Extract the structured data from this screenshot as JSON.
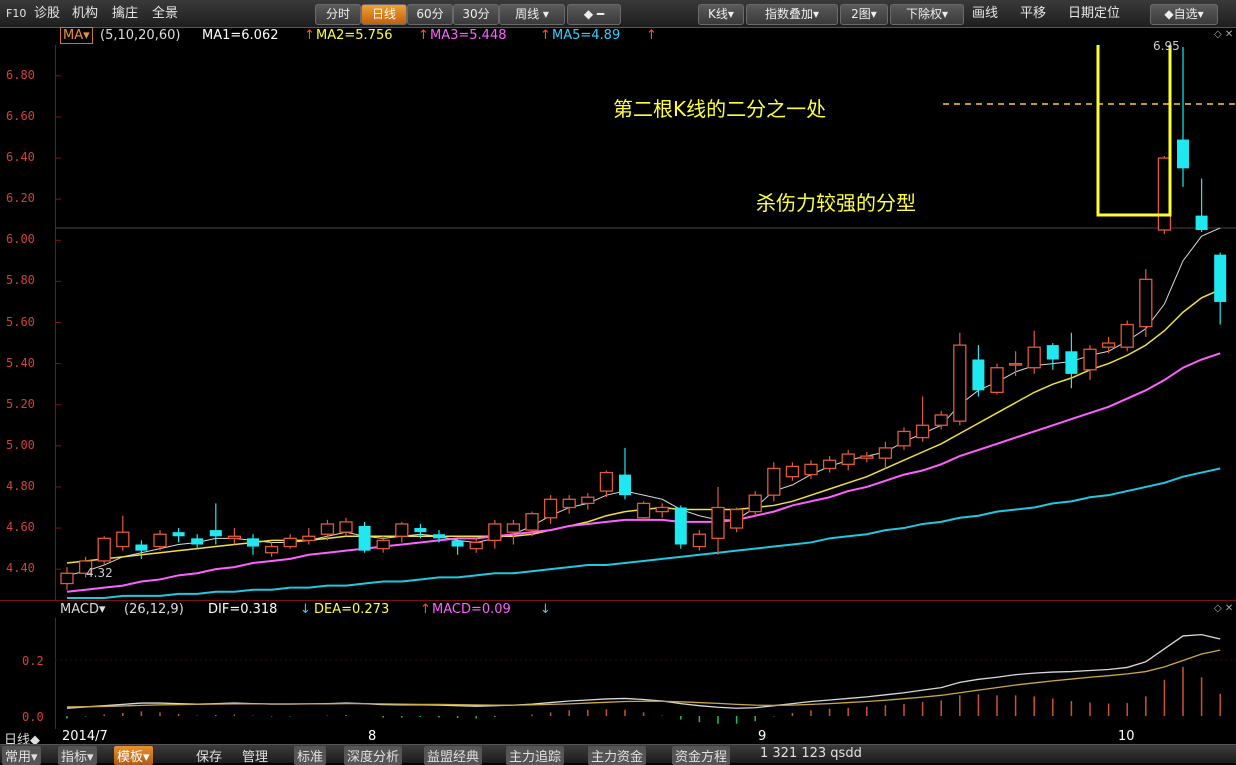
{
  "toolbar": {
    "left": [
      "F10",
      "诊股",
      "机构",
      "擒庄",
      "全景"
    ],
    "periods": [
      {
        "label": "分时",
        "active": false
      },
      {
        "label": "日线",
        "active": true
      },
      {
        "label": "60分",
        "active": false
      },
      {
        "label": "30分",
        "active": false
      },
      {
        "label": "周线 ▾",
        "active": false
      }
    ],
    "nav_arrows": "◆ ━",
    "right": [
      "K线▾",
      "指数叠加▾",
      "2图▾",
      "下除权▾",
      "画线",
      "平移",
      "日期定位",
      "◆自选▾"
    ]
  },
  "ma_bar": {
    "selector": "MA▾",
    "params": "(5,10,20,60)",
    "ma1": "MA1=6.062",
    "ma2": "MA2=5.756",
    "ma3": "MA3=5.448",
    "ma5": "MA5=4.89",
    "arrow_up": "↑"
  },
  "price_axis": [
    "6.80",
    "6.60",
    "6.40",
    "6.20",
    "6.00",
    "5.80",
    "5.60",
    "5.40",
    "5.20",
    "5.00",
    "4.80",
    "4.60",
    "4.40"
  ],
  "annotations": {
    "half_line": "第二根K线的二分之一处",
    "fractal": "杀伤力较强的分型",
    "high_label": "6.95",
    "low_label": "4.32"
  },
  "macd_bar": {
    "selector": "MACD▾",
    "params": "(26,12,9)",
    "dif": "DIF=0.318",
    "dea": "DEA=0.273",
    "macd": "MACD=0.09",
    "arrow_down": "↓",
    "arrow_up": "↑"
  },
  "macd_axis": [
    "0.2",
    "0.0"
  ],
  "date_axis": {
    "period_label": "日线◆",
    "start": "2014/7",
    "marks": [
      "8",
      "9",
      "10"
    ]
  },
  "bottom_tabs": [
    {
      "label": "常用▾",
      "on": false
    },
    {
      "label": "指标▾",
      "on": false
    },
    {
      "label": "模板▾",
      "on": true
    },
    {
      "label": "保存",
      "on": false
    },
    {
      "label": "管理",
      "on": false
    },
    {
      "label": "标准",
      "on": false
    },
    {
      "label": "深度分析",
      "on": false
    },
    {
      "label": "益盟经典",
      "on": false
    },
    {
      "label": "主力追踪",
      "on": false
    },
    {
      "label": "主力资金",
      "on": false
    },
    {
      "label": "资金方程",
      "on": false
    },
    {
      "label": "1 321 123 qsdd",
      "on": false
    }
  ],
  "chart_data": {
    "type": "candlestick",
    "ylim": [
      4.25,
      6.95
    ],
    "candles": [
      [
        4.33,
        4.38,
        4.3,
        4.41
      ],
      [
        4.38,
        4.44,
        4.36,
        4.46
      ],
      [
        4.44,
        4.55,
        4.42,
        4.56
      ],
      [
        4.51,
        4.58,
        4.49,
        4.66
      ],
      [
        4.52,
        4.49,
        4.45,
        4.54
      ],
      [
        4.51,
        4.57,
        4.49,
        4.59
      ],
      [
        4.58,
        4.56,
        4.53,
        4.6
      ],
      [
        4.55,
        4.52,
        4.5,
        4.57
      ],
      [
        4.59,
        4.56,
        4.52,
        4.72
      ],
      [
        4.55,
        4.56,
        4.52,
        4.6
      ],
      [
        4.55,
        4.51,
        4.47,
        4.57
      ],
      [
        4.48,
        4.51,
        4.46,
        4.53
      ],
      [
        4.51,
        4.55,
        4.5,
        4.57
      ],
      [
        4.54,
        4.56,
        4.52,
        4.6
      ],
      [
        4.57,
        4.62,
        4.54,
        4.64
      ],
      [
        4.58,
        4.63,
        4.56,
        4.65
      ],
      [
        4.61,
        4.49,
        4.48,
        4.63
      ],
      [
        4.5,
        4.54,
        4.48,
        4.56
      ],
      [
        4.56,
        4.62,
        4.53,
        4.63
      ],
      [
        4.6,
        4.58,
        4.55,
        4.62
      ],
      [
        4.57,
        4.55,
        4.53,
        4.59
      ],
      [
        4.54,
        4.51,
        4.47,
        4.55
      ],
      [
        4.5,
        4.53,
        4.48,
        4.55
      ],
      [
        4.54,
        4.62,
        4.5,
        4.64
      ],
      [
        4.58,
        4.62,
        4.52,
        4.64
      ],
      [
        4.59,
        4.67,
        4.56,
        4.68
      ],
      [
        4.65,
        4.74,
        4.62,
        4.76
      ],
      [
        4.7,
        4.74,
        4.67,
        4.76
      ],
      [
        4.72,
        4.75,
        4.69,
        4.77
      ],
      [
        4.78,
        4.87,
        4.75,
        4.88
      ],
      [
        4.86,
        4.76,
        4.74,
        4.99
      ],
      [
        4.65,
        4.72,
        4.64,
        4.73
      ],
      [
        4.68,
        4.7,
        4.65,
        4.72
      ],
      [
        4.7,
        4.52,
        4.5,
        4.71
      ],
      [
        4.51,
        4.57,
        4.49,
        4.59
      ],
      [
        4.55,
        4.7,
        4.47,
        4.8
      ],
      [
        4.6,
        4.69,
        4.58,
        4.7
      ],
      [
        4.68,
        4.76,
        4.66,
        4.78
      ],
      [
        4.76,
        4.89,
        4.73,
        4.92
      ],
      [
        4.85,
        4.9,
        4.83,
        4.92
      ],
      [
        4.86,
        4.91,
        4.84,
        4.93
      ],
      [
        4.89,
        4.93,
        4.87,
        4.95
      ],
      [
        4.91,
        4.96,
        4.88,
        4.98
      ],
      [
        4.94,
        4.95,
        4.92,
        4.97
      ],
      [
        4.94,
        4.99,
        4.89,
        5.02
      ],
      [
        5.0,
        5.07,
        4.98,
        5.09
      ],
      [
        5.04,
        5.1,
        5.02,
        5.24
      ],
      [
        5.1,
        5.15,
        5.08,
        5.17
      ],
      [
        5.12,
        5.49,
        5.1,
        5.55
      ],
      [
        5.42,
        5.27,
        5.24,
        5.49
      ],
      [
        5.26,
        5.38,
        5.25,
        5.4
      ],
      [
        5.4,
        5.4,
        5.34,
        5.46
      ],
      [
        5.38,
        5.48,
        5.35,
        5.56
      ],
      [
        5.49,
        5.42,
        5.37,
        5.5
      ],
      [
        5.46,
        5.35,
        5.28,
        5.55
      ],
      [
        5.37,
        5.47,
        5.32,
        5.49
      ],
      [
        5.48,
        5.5,
        5.45,
        5.53
      ],
      [
        5.48,
        5.59,
        5.46,
        5.61
      ],
      [
        5.58,
        5.81,
        5.53,
        5.86
      ],
      [
        6.05,
        6.4,
        6.03,
        6.41
      ],
      [
        6.49,
        6.35,
        6.26,
        6.94
      ],
      [
        6.12,
        6.05,
        6.04,
        6.3
      ],
      [
        5.93,
        5.7,
        5.59,
        5.94
      ]
    ],
    "series": [
      {
        "name": "MA1",
        "values": [
          4.37,
          4.39,
          4.42,
          4.46,
          4.48,
          4.5,
          4.52,
          4.53,
          4.55,
          4.55,
          4.54,
          4.53,
          4.53,
          4.54,
          4.56,
          4.58,
          4.56,
          4.55,
          4.56,
          4.57,
          4.56,
          4.54,
          4.53,
          4.55,
          4.57,
          4.61,
          4.66,
          4.7,
          4.72,
          4.76,
          4.78,
          4.76,
          4.74,
          4.69,
          4.66,
          4.64,
          4.64,
          4.7,
          4.78,
          4.81,
          4.86,
          4.9,
          4.93,
          4.95,
          4.97,
          5.02,
          5.06,
          5.1,
          5.2,
          5.27,
          5.31,
          5.36,
          5.39,
          5.4,
          5.41,
          5.44,
          5.46,
          5.51,
          5.57,
          5.69,
          5.9,
          6.02,
          6.06
        ]
      },
      {
        "name": "MA2",
        "values": [
          4.43,
          4.44,
          4.45,
          4.46,
          4.47,
          4.48,
          4.49,
          4.5,
          4.51,
          4.52,
          4.53,
          4.54,
          4.54,
          4.54,
          4.55,
          4.56,
          4.56,
          4.56,
          4.56,
          4.56,
          4.56,
          4.56,
          4.56,
          4.56,
          4.56,
          4.57,
          4.59,
          4.61,
          4.63,
          4.66,
          4.68,
          4.69,
          4.7,
          4.69,
          4.69,
          4.69,
          4.69,
          4.7,
          4.71,
          4.73,
          4.76,
          4.79,
          4.82,
          4.85,
          4.89,
          4.93,
          4.97,
          5.01,
          5.06,
          5.11,
          5.16,
          5.21,
          5.26,
          5.3,
          5.33,
          5.37,
          5.4,
          5.44,
          5.49,
          5.56,
          5.65,
          5.72,
          5.76
        ]
      },
      {
        "name": "MA3",
        "values": [
          4.29,
          4.3,
          4.31,
          4.32,
          4.34,
          4.35,
          4.37,
          4.38,
          4.4,
          4.41,
          4.43,
          4.44,
          4.45,
          4.47,
          4.48,
          4.49,
          4.5,
          4.51,
          4.52,
          4.53,
          4.54,
          4.55,
          4.55,
          4.56,
          4.57,
          4.58,
          4.59,
          4.61,
          4.62,
          4.63,
          4.64,
          4.64,
          4.64,
          4.63,
          4.63,
          4.63,
          4.64,
          4.66,
          4.68,
          4.71,
          4.73,
          4.75,
          4.78,
          4.8,
          4.83,
          4.86,
          4.88,
          4.91,
          4.95,
          4.98,
          5.01,
          5.04,
          5.07,
          5.1,
          5.13,
          5.16,
          5.19,
          5.23,
          5.27,
          5.32,
          5.38,
          5.42,
          5.45
        ]
      },
      {
        "name": "MA5",
        "values": [
          4.26,
          4.26,
          4.26,
          4.27,
          4.27,
          4.27,
          4.28,
          4.28,
          4.29,
          4.29,
          4.3,
          4.3,
          4.31,
          4.31,
          4.32,
          4.32,
          4.33,
          4.34,
          4.34,
          4.35,
          4.36,
          4.36,
          4.37,
          4.38,
          4.38,
          4.39,
          4.4,
          4.41,
          4.42,
          4.42,
          4.43,
          4.44,
          4.45,
          4.46,
          4.47,
          4.48,
          4.49,
          4.5,
          4.51,
          4.52,
          4.53,
          4.55,
          4.56,
          4.57,
          4.59,
          4.6,
          4.62,
          4.63,
          4.65,
          4.66,
          4.68,
          4.69,
          4.7,
          4.72,
          4.73,
          4.75,
          4.76,
          4.78,
          4.8,
          4.82,
          4.85,
          4.87,
          4.89
        ]
      }
    ],
    "macd": {
      "ylim": [
        0.0,
        0.36
      ],
      "dif": [
        0.03,
        0.035,
        0.04,
        0.045,
        0.05,
        0.05,
        0.048,
        0.046,
        0.048,
        0.05,
        0.048,
        0.046,
        0.046,
        0.047,
        0.048,
        0.05,
        0.048,
        0.044,
        0.043,
        0.043,
        0.042,
        0.04,
        0.038,
        0.04,
        0.042,
        0.046,
        0.052,
        0.058,
        0.062,
        0.066,
        0.068,
        0.064,
        0.058,
        0.048,
        0.04,
        0.034,
        0.03,
        0.032,
        0.04,
        0.048,
        0.056,
        0.062,
        0.068,
        0.074,
        0.082,
        0.09,
        0.1,
        0.11,
        0.13,
        0.142,
        0.15,
        0.16,
        0.166,
        0.17,
        0.172,
        0.176,
        0.18,
        0.188,
        0.21,
        0.26,
        0.31,
        0.315,
        0.298
      ],
      "dea": [
        0.035,
        0.036,
        0.037,
        0.039,
        0.041,
        0.043,
        0.044,
        0.045,
        0.046,
        0.047,
        0.047,
        0.047,
        0.047,
        0.047,
        0.047,
        0.048,
        0.048,
        0.047,
        0.046,
        0.045,
        0.045,
        0.044,
        0.043,
        0.042,
        0.042,
        0.043,
        0.045,
        0.047,
        0.05,
        0.053,
        0.056,
        0.057,
        0.057,
        0.055,
        0.052,
        0.049,
        0.045,
        0.042,
        0.041,
        0.042,
        0.045,
        0.048,
        0.052,
        0.056,
        0.061,
        0.067,
        0.073,
        0.08,
        0.09,
        0.1,
        0.11,
        0.12,
        0.128,
        0.136,
        0.143,
        0.15,
        0.156,
        0.163,
        0.172,
        0.19,
        0.215,
        0.24,
        0.255
      ]
    }
  }
}
